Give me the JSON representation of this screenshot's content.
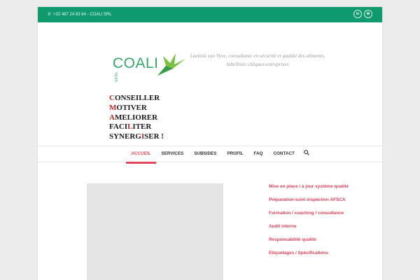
{
  "topbar": {
    "phone_icon": "phone-icon",
    "contact_text": "+32 487 24 83 64 - COALI SRL",
    "social": [
      {
        "icon": "linkedin-icon",
        "label": "in"
      },
      {
        "icon": "email-icon",
        "label": "✉"
      }
    ],
    "background": "#0f9a6e"
  },
  "header": {
    "logo_text": "COALI",
    "logo_sub": "SPRL",
    "logo_icon": "hummingbird-icon",
    "tagline": "Laetitia van Vyve, consultante en sécurité et qualité des aliments, labellisée chèques-entreprises",
    "motto": [
      {
        "pre": "",
        "hl": "C",
        "post": "ONSEILLER"
      },
      {
        "pre": "",
        "hl": "M",
        "post": "OTIVER"
      },
      {
        "pre": "",
        "hl": "A",
        "post": "MELIORER"
      },
      {
        "pre": "FACI",
        "hl": "L",
        "post": "ITER"
      },
      {
        "pre": "SYNERG",
        "hl": "I",
        "post": "SER !"
      }
    ]
  },
  "nav": {
    "items": [
      {
        "label": "ACCUEIL",
        "active": true
      },
      {
        "label": "SERVICES",
        "active": false
      },
      {
        "label": "SUBSIDES",
        "active": false
      },
      {
        "label": "PROFIL",
        "active": false
      },
      {
        "label": "FAQ",
        "active": false
      },
      {
        "label": "CONTACT",
        "active": false
      }
    ],
    "search_icon": "search-icon",
    "accent": "#e04a5b"
  },
  "sidebar_links": [
    "Mise en place / à jour système qualité",
    "Préparation-suivi inspection AFSCA",
    "Formation / coaching / consultance",
    "Audit interne",
    "Responsabilité qualité",
    "Etiquetages / Spécifications"
  ]
}
